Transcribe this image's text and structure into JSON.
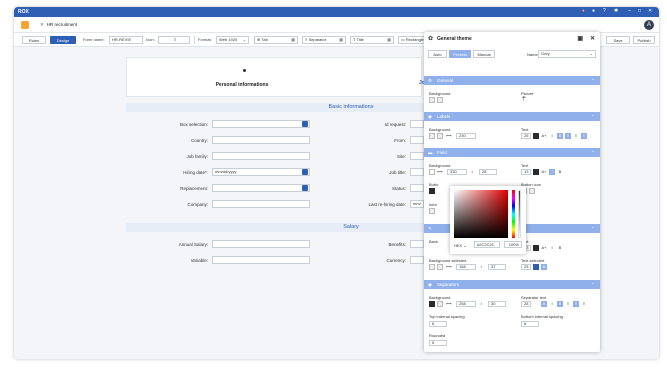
{
  "app": {
    "logo": "ROX",
    "tab_title": "HR recruitment",
    "avatar_initial": "A"
  },
  "toolbar": {
    "rules": "Rules",
    "design": "Design",
    "form_name_label": "Form name:",
    "form_name_value": "HR-REVIE",
    "icon_label": "Icon:",
    "format_label": "Format:",
    "format_value": "Web 1920",
    "tab": "Tab",
    "separator": "Separator",
    "title": "Title",
    "rectangle": "Rectangle"
  },
  "header_buttons": {
    "save": "Save",
    "publish": "Publish"
  },
  "form": {
    "step_title": "Personal informations",
    "step_title_next": "Jo",
    "basic_section": "Basic informations",
    "salary_section": "Salary",
    "left_fields": [
      {
        "label": "Box selection:",
        "value": ""
      },
      {
        "label": "Country:",
        "value": ""
      },
      {
        "label": "Job family:",
        "value": ""
      },
      {
        "label": "Hiring date*:",
        "value": "mm/dd/yyyy"
      },
      {
        "label": "Replacement:",
        "value": ""
      },
      {
        "label": "Company:",
        "value": ""
      }
    ],
    "right_fields": [
      {
        "label": "Id request:",
        "value": ""
      },
      {
        "label": "From:",
        "value": ""
      },
      {
        "label": "Site:",
        "value": ""
      },
      {
        "label": "Job title:",
        "value": ""
      },
      {
        "label": "Status:",
        "value": ""
      },
      {
        "label": "Last re-hiring date:",
        "value": "mm/"
      }
    ],
    "salary_left": [
      {
        "label": "Annual Salary:",
        "value": ""
      },
      {
        "label": "Variable:",
        "value": ""
      }
    ],
    "salary_right": [
      {
        "label": "Benefits:",
        "value": ""
      },
      {
        "label": "Currency:",
        "value": ""
      }
    ]
  },
  "panel": {
    "title": "General theme",
    "modes": [
      "Auto",
      "Presets",
      "Manual"
    ],
    "name_label": "Name",
    "name_value": "Grey",
    "sections": {
      "general": "General",
      "labels": "Labels",
      "field": "Field",
      "buttons": "",
      "separators": "Separators"
    },
    "general": {
      "background": "Background",
      "picture": "Picture"
    },
    "labels": {
      "background": "Background",
      "width": "230",
      "text": "Text",
      "text_size": "25",
      "text_size_label": "A+",
      "italic": "I",
      "bold": "B"
    },
    "field": {
      "background": "Background",
      "width": "330",
      "height": "28",
      "text": "Text",
      "text_size": "13",
      "text_size_label": "A+",
      "bold": "B",
      "button_label": "Butto",
      "button_icon": "Button icon",
      "inline_label": "Infor"
    },
    "buttons": {
      "background": "Back",
      "text": "Text",
      "text_size": "13",
      "text_size_label": "A+",
      "italic": "I",
      "bold": "B",
      "bg_selected": "Background selected",
      "bg_selected_width": "158",
      "bg_selected_height": "37",
      "text_selected": "Text selected",
      "text_selected_size": "25",
      "text_selected_bold": "B"
    },
    "separators": {
      "background": "Background",
      "width": "258",
      "height": "30",
      "sep_text": "Separator text",
      "sep_text_size": "28",
      "italic": "I",
      "bold": "B",
      "top_spacing": "Top internal spacing",
      "top_spacing_value": "6",
      "bottom_spacing": "Bottom internal spacing",
      "bottom_spacing_value": "6",
      "rounded": "Rounded",
      "rounded_value": "5"
    },
    "picker": {
      "format": "HEX",
      "hex": "#2C2C2C",
      "alpha": "100%"
    }
  },
  "colors": {
    "accent": "#2f5fb4",
    "accent_light": "#8fb0ea",
    "app_icon": "#f1a533"
  }
}
